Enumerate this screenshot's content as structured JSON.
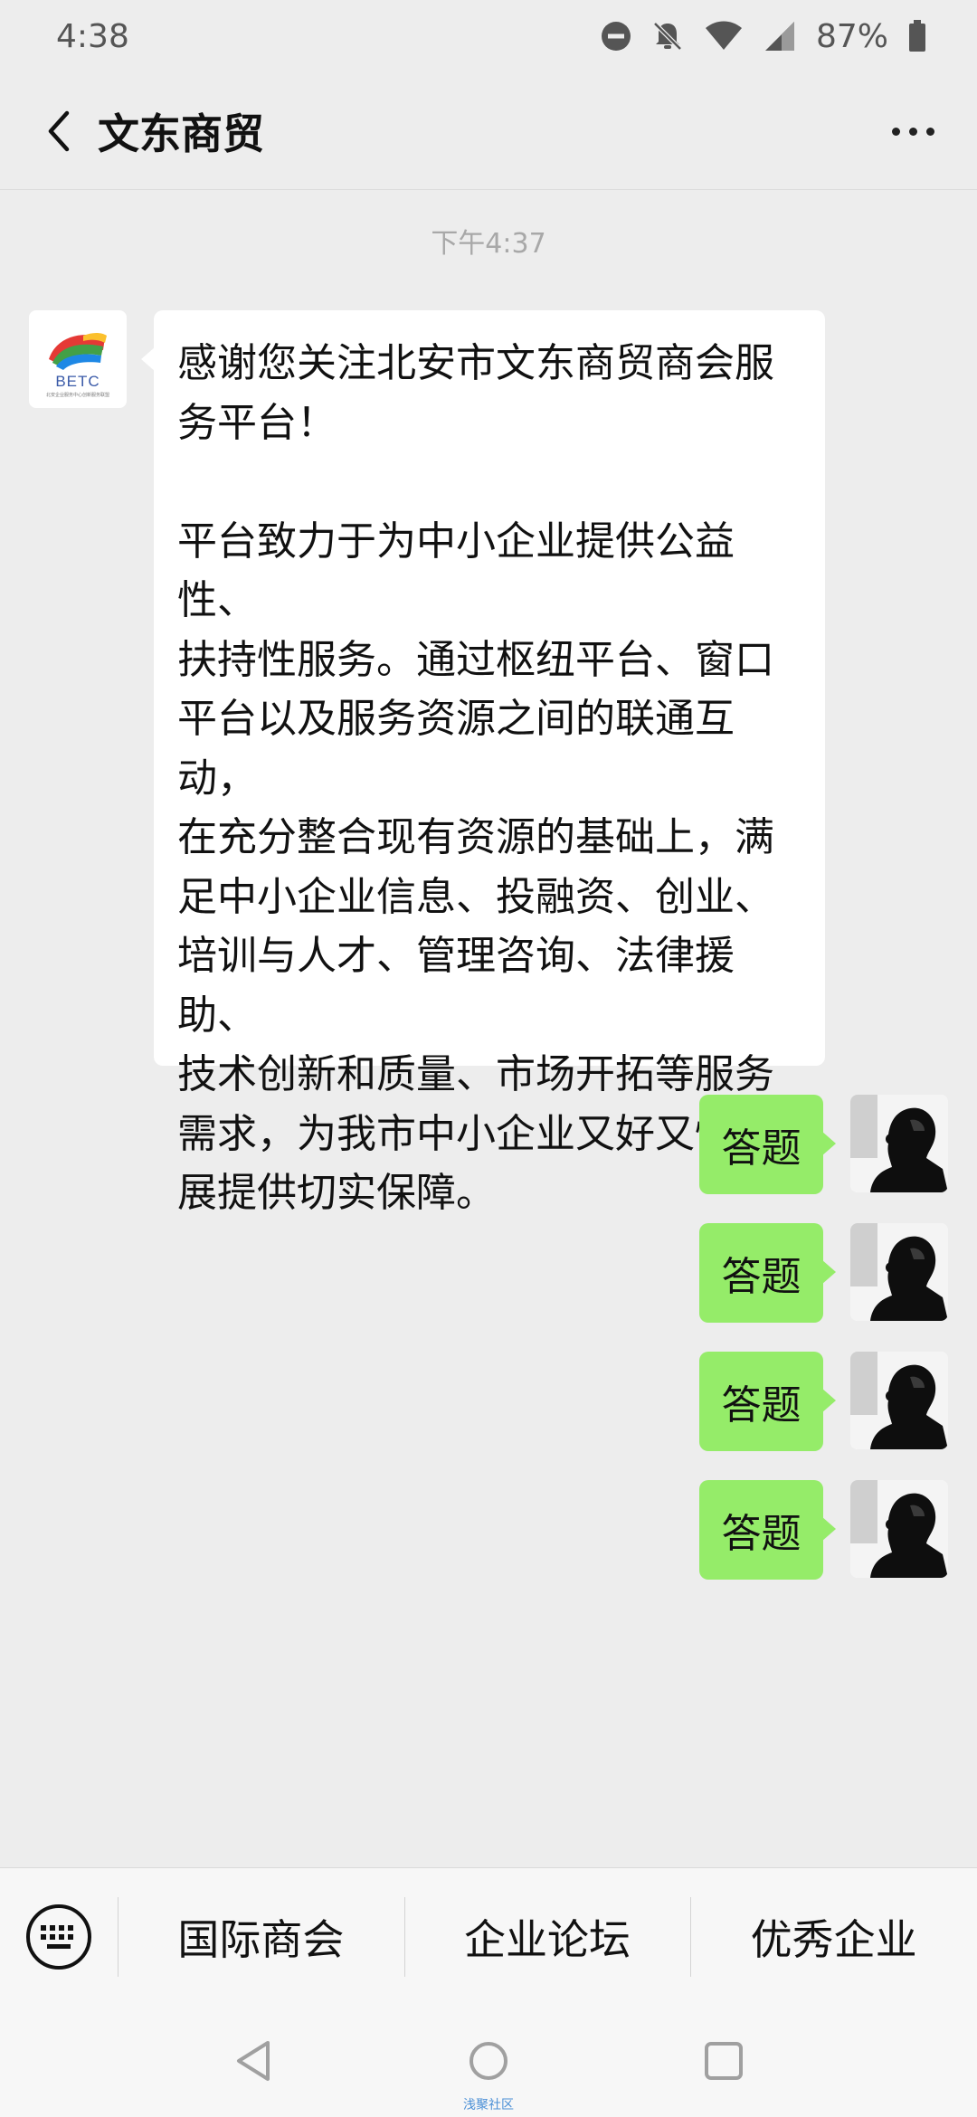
{
  "status_bar": {
    "time": "4:38",
    "battery": "87%",
    "icons": [
      "do-not-disturb-icon",
      "notifications-off-icon",
      "wifi-icon",
      "signal-icon",
      "battery-icon"
    ]
  },
  "header": {
    "title": "文东商贸",
    "back_icon": "chevron-left-icon",
    "more_icon": "more-dots-icon"
  },
  "chat": {
    "timestamp": "下午4:37",
    "incoming": {
      "avatar_logo_text": "BETC",
      "avatar_logo_subtext": "北安企业服务中心创新服务联盟",
      "text": "感谢您关注北安市文东商贸商会服\n务平台！\n\n平台致力于为中小企业提供公益性、\n扶持性服务。通过枢纽平台、窗口\n平台以及服务资源之间的联通互动，\n在充分整合现有资源的基础上，满\n足中小企业信息、投融资、创业、\n培训与人才、管理咨询、法律援助、\n技术创新和质量、市场开拓等服务\n需求，为我市中小企业又好又快发\n展提供切实保障。"
    },
    "outgoing": [
      {
        "text": "答题"
      },
      {
        "text": "答题"
      },
      {
        "text": "答题"
      },
      {
        "text": "答题"
      }
    ]
  },
  "menu": {
    "keyboard_icon": "keyboard-icon",
    "items": [
      "国际商会",
      "企业论坛",
      "优秀企业"
    ]
  },
  "nav": {
    "icons": [
      "nav-back-icon",
      "nav-home-icon",
      "nav-recents-icon"
    ],
    "watermark": "浅聚社区"
  },
  "colors": {
    "background": "#ededed",
    "outgoing_bubble": "#95ec69",
    "incoming_bubble": "#ffffff"
  }
}
